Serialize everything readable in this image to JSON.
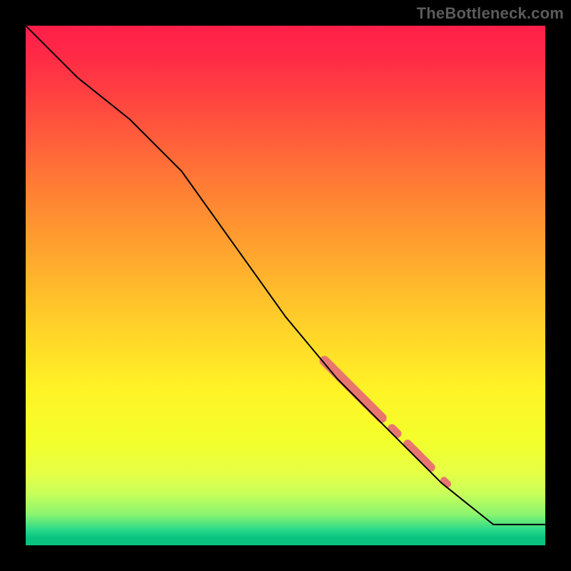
{
  "watermark": "TheBottleneck.com",
  "colors": {
    "line": "#000000",
    "accent": "#e8766f",
    "background_black": "#000000"
  },
  "chart_data": {
    "type": "line",
    "title": "",
    "xlabel": "",
    "ylabel": "",
    "xlim": [
      0,
      1
    ],
    "ylim": [
      0,
      1
    ],
    "grid": false,
    "legend": false,
    "note": "Axes are unlabeled in the source image; x/y are normalized 0–1 within the plot area. y=1 is the top edge (red), y=0 is the bottom (green).",
    "series": [
      {
        "name": "main-curve",
        "x": [
          0.0,
          0.05,
          0.1,
          0.15,
          0.2,
          0.25,
          0.3,
          0.35,
          0.4,
          0.45,
          0.5,
          0.55,
          0.6,
          0.65,
          0.7,
          0.75,
          0.8,
          0.85,
          0.9,
          0.95,
          1.0
        ],
        "y": [
          1.0,
          0.95,
          0.9,
          0.86,
          0.82,
          0.77,
          0.72,
          0.65,
          0.58,
          0.51,
          0.44,
          0.38,
          0.32,
          0.27,
          0.22,
          0.17,
          0.12,
          0.08,
          0.04,
          0.04,
          0.04
        ],
        "stroke": "#000000",
        "width": 2
      }
    ],
    "highlight_segments": [
      {
        "name": "accent-thick-upper",
        "x0": 0.575,
        "y0": 0.355,
        "x1": 0.685,
        "y1": 0.245,
        "width": 14,
        "color": "#e8766f",
        "cap": "round"
      },
      {
        "name": "accent-dot-mid",
        "x0": 0.705,
        "y0": 0.225,
        "x1": 0.715,
        "y1": 0.215,
        "width": 12,
        "color": "#e8766f",
        "cap": "round"
      },
      {
        "name": "accent-thick-lower",
        "x0": 0.735,
        "y0": 0.195,
        "x1": 0.78,
        "y1": 0.15,
        "width": 12,
        "color": "#e8766f",
        "cap": "round"
      },
      {
        "name": "accent-dot-bottom",
        "x0": 0.805,
        "y0": 0.125,
        "x1": 0.812,
        "y1": 0.118,
        "width": 10,
        "color": "#e8766f",
        "cap": "round"
      }
    ]
  }
}
